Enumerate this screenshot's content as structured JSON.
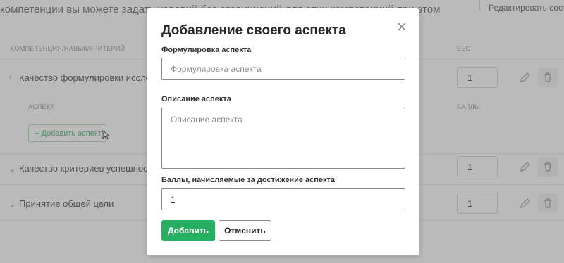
{
  "background": {
    "intro_text": "компетенции вы можете задать условий без ограничений для этих компетенций при этом",
    "edit_button": "Редактировать состав",
    "col_competency": "КОМПЕТЕНЦИЯ/НАВЫК/КРИТЕРИЙ",
    "col_weight": "ВЕС",
    "col_aspect": "АСПЕКТ",
    "col_points": "БАЛЛЫ",
    "add_aspect_button": "+ Добавить аспект",
    "rows": [
      {
        "label": "Качество формулировки исследоват...",
        "weight": "1"
      },
      {
        "label": "Качество критериев успешности прое...",
        "weight": "1"
      },
      {
        "label": "Принятие общей цели",
        "weight": "1"
      }
    ]
  },
  "modal": {
    "title": "Добавление своего аспекта",
    "formulation_label": "Формулировка аспекта",
    "formulation_placeholder": "Формулировка аспекта",
    "formulation_value": "",
    "description_label": "Описание аспекта",
    "description_placeholder": "Описание аспекта",
    "description_value": "",
    "points_label": "Баллы, начисляемые за достижение аспекта",
    "points_value": "1",
    "submit_button": "Добавить",
    "cancel_button": "Отменить"
  },
  "colors": {
    "accent": "#27ae60",
    "overlay": "rgba(110,110,110,0.48)"
  },
  "icons": [
    "close-icon",
    "pencil-icon",
    "trash-icon",
    "chevron-right-icon",
    "chevron-down-icon",
    "cursor-icon"
  ]
}
